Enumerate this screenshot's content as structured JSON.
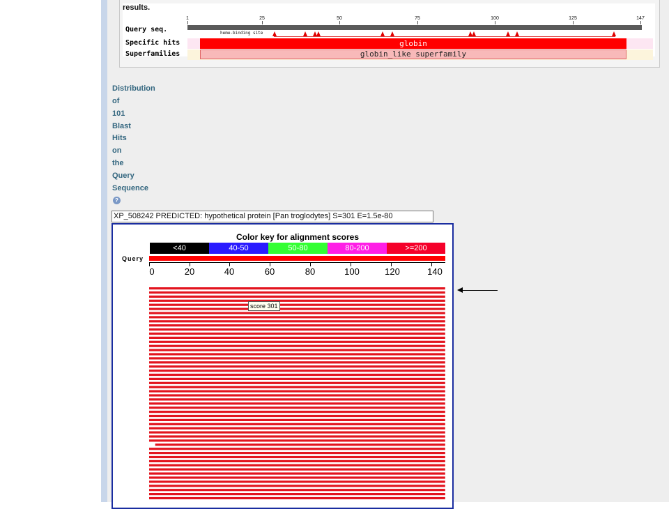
{
  "cdd": {
    "results_text": "results.",
    "row_labels": {
      "query": "Query seq.",
      "specific": "Specific hits",
      "superfamilies": "Superfamilies"
    },
    "ticks": [
      "1",
      "25",
      "50",
      "75",
      "100",
      "125",
      "147"
    ],
    "site_label": "heme-binding site",
    "specific_hit": "globin",
    "superfamily_hit": "globin_like superfamily"
  },
  "distribution": {
    "heading_words": [
      "Distribution",
      "of",
      "101",
      "Blast",
      "Hits",
      "on",
      "the",
      "Query",
      "Sequence"
    ],
    "help_symbol": "?",
    "selected_hit": "XP_508242 PREDICTED: hypothetical protein [Pan troglodytes] S=301 E=1.5e-80"
  },
  "alignment_graphic": {
    "key_title": "Color key for alignment scores",
    "color_key": [
      {
        "label": "<40",
        "color": "#000000"
      },
      {
        "label": "40-50",
        "color": "#2a1cff"
      },
      {
        "label": "50-80",
        "color": "#33ff33"
      },
      {
        "label": "80-200",
        "color": "#ff1fe6"
      },
      {
        "label": ">=200",
        "color": "#f5002a"
      }
    ],
    "query_label": "Query",
    "axis_ticks": [
      "0",
      "20",
      "40",
      "60",
      "80",
      "100",
      "120",
      "140"
    ],
    "tooltip": "score 301",
    "hit_color": "#e3141e"
  },
  "chart_data": {
    "type": "bar",
    "title": "Color key for alignment scores",
    "xlabel": "Query",
    "xlim": [
      0,
      147
    ],
    "hits_visible": 53,
    "hits_total": 101,
    "hit_spans": [
      {
        "row": 1,
        "start": 0,
        "end": 147,
        "score": 301
      }
    ],
    "short_hit": {
      "row": 38,
      "start": 3,
      "end": 147
    }
  }
}
